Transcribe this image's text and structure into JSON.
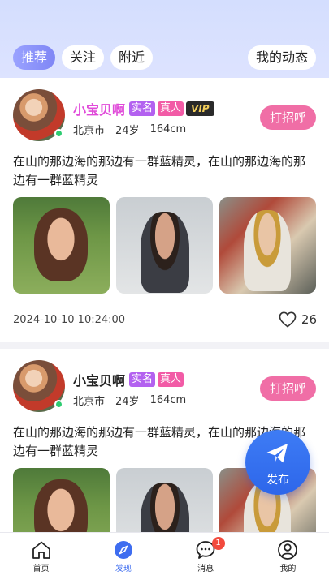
{
  "header": {
    "tabs": [
      {
        "label": "推荐",
        "active": true
      },
      {
        "label": "关注",
        "active": false
      },
      {
        "label": "附近",
        "active": false
      }
    ],
    "my_post_label": "我的动态"
  },
  "posts": [
    {
      "name": "小宝贝啊",
      "badges": [
        "实名",
        "真人",
        "VIP"
      ],
      "city": "北京市",
      "age": "24岁",
      "height": "164cm",
      "greet_label": "打招呼",
      "content": "在山的那边海的那边有一群蓝精灵，在山的那边海的那边有一群蓝精灵",
      "timestamp": "2024-10-10 10:24:00",
      "likes": "26"
    },
    {
      "name": "小宝贝啊",
      "badges": [
        "实名",
        "真人"
      ],
      "city": "北京市",
      "age": "24岁",
      "height": "164cm",
      "greet_label": "打招呼",
      "content": "在山的那边海的那边有一群蓝精灵，在山的那边海的那边有一群蓝精灵"
    }
  ],
  "fab": {
    "label": "发布"
  },
  "bottom_nav": {
    "items": [
      {
        "label": "首页",
        "icon": "home-icon"
      },
      {
        "label": "发现",
        "icon": "compass-icon",
        "active": true
      },
      {
        "label": "消息",
        "icon": "chat-icon",
        "badge": "1"
      },
      {
        "label": "我的",
        "icon": "user-icon"
      }
    ]
  },
  "colors": {
    "accent": "#7f86f5",
    "greet": "#f06ea6",
    "fab": "#2d66ea",
    "nav_active": "#3e6df0"
  }
}
